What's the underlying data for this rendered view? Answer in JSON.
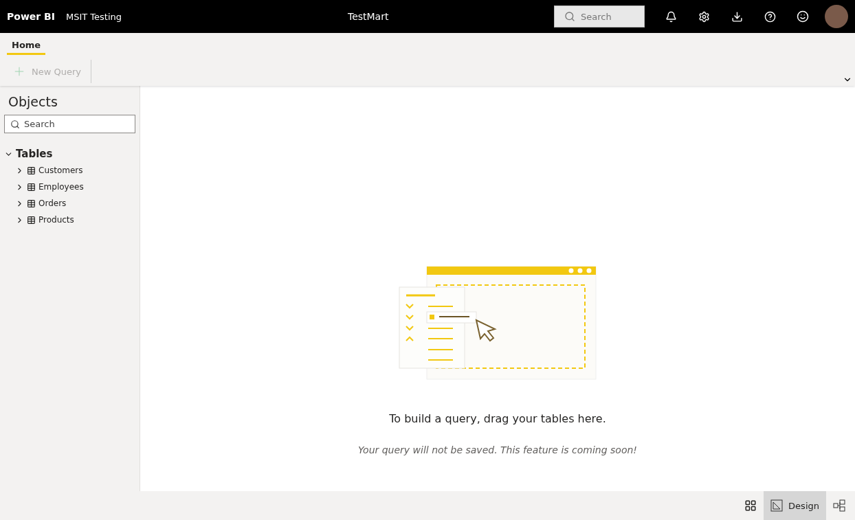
{
  "header": {
    "brand": "Power BI",
    "workspace": "MSIT Testing",
    "title": "TestMart",
    "search": {
      "placeholder": "Search"
    }
  },
  "ribbon": {
    "tabs": [
      {
        "label": "Home",
        "selected": true
      }
    ],
    "actions": [
      {
        "label": "New Query",
        "disabled": true
      }
    ]
  },
  "sidebar": {
    "title": "Objects",
    "search": {
      "placeholder": "Search"
    },
    "tree": [
      {
        "label": "Tables",
        "expanded": true,
        "children": [
          {
            "label": "Customers",
            "expanded": false
          },
          {
            "label": "Employees",
            "expanded": false
          },
          {
            "label": "Orders",
            "expanded": false
          },
          {
            "label": "Products",
            "expanded": false
          }
        ]
      }
    ]
  },
  "canvas": {
    "heading": "To build a query, drag your tables here.",
    "note": "Your query will not be saved. This feature is coming soon!"
  },
  "view_buttons": [
    {
      "kind": "table",
      "selected": false
    },
    {
      "kind": "design",
      "label": "Design",
      "selected": true
    },
    {
      "kind": "model",
      "selected": false
    }
  ]
}
